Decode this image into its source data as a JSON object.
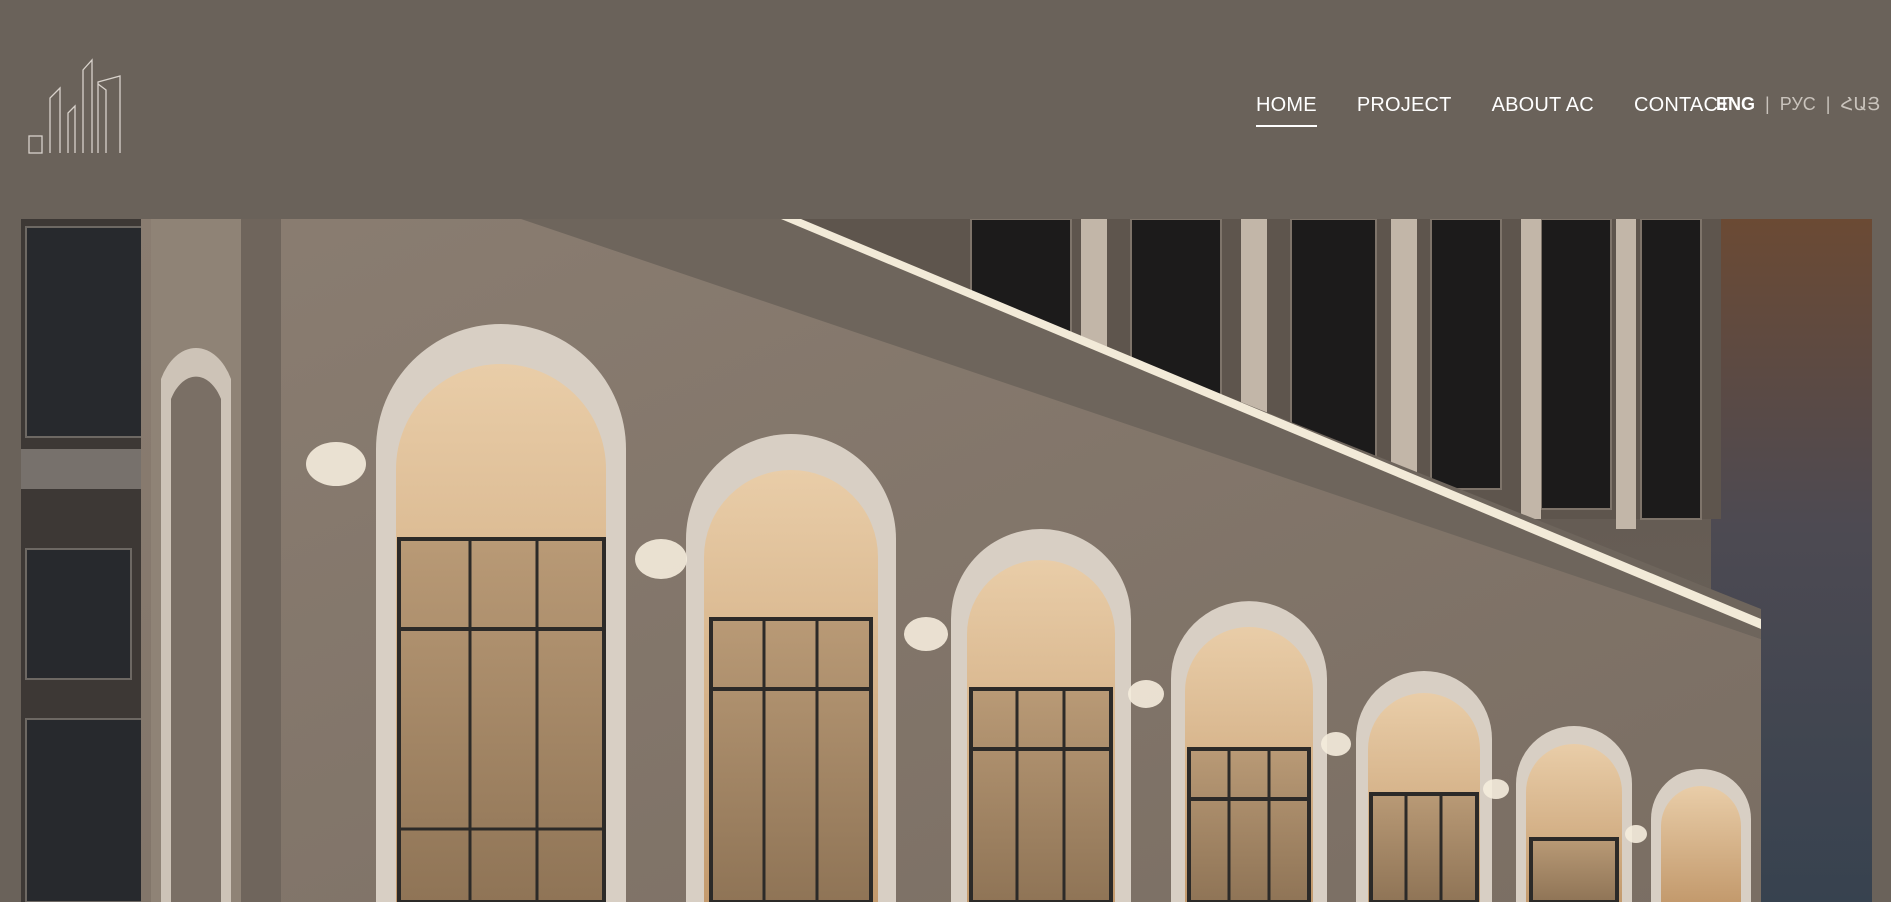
{
  "nav": {
    "items": [
      {
        "label": "HOME",
        "active": true
      },
      {
        "label": "PROJECT",
        "active": false
      },
      {
        "label": "ABOUT AC",
        "active": false
      },
      {
        "label": "CONTACT",
        "active": false
      }
    ]
  },
  "languages": {
    "items": [
      {
        "label": "ENG",
        "active": true
      },
      {
        "label": "РУС",
        "active": false
      },
      {
        "label": "ՀԱՅ",
        "active": false
      }
    ],
    "separator": "|"
  },
  "colors": {
    "header_bg": "#6a625a",
    "nav_text": "#ffffff",
    "lang_inactive": "#c9c3bc",
    "arch_light": "#e8ddd0",
    "window_glow": "#e6c9a5"
  },
  "icons": {
    "logo": "city-buildings-outline-logo"
  },
  "hero": {
    "image": "building-facade-arches-night-render"
  }
}
